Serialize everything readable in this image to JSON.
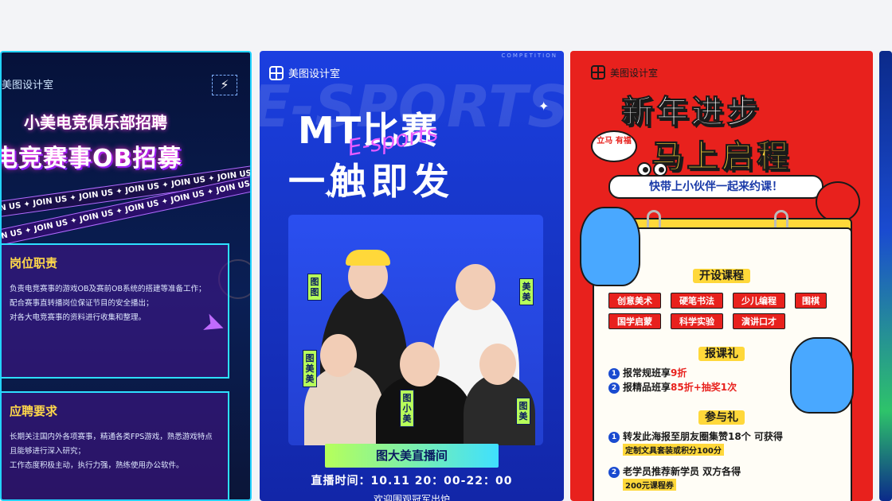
{
  "cards": [
    {
      "brand": "美图设计室",
      "subtitle": "小美电竞俱乐部招聘",
      "title": "电竞赛事OB招募",
      "ribbon": "JOIN US ✦ JOIN US ✦ JOIN US ✦ JOIN US ✦ JOIN US ✦ JOIN US",
      "section1": {
        "heading": "岗位职责",
        "lines": [
          "负责电竞赛事的游戏OB及赛前OB系统的搭建等准备工作；",
          "配合赛事直转播岗位保证节目的安全播出；",
          "对各大电竞赛事的资料进行收集和整理。"
        ]
      },
      "section2": {
        "heading": "应聘要求",
        "lines": [
          "长期关注国内外各项赛事，精通各类FPS游戏，熟悉游戏特点且能够进行深入研究；",
          "工作态度积极主动，执行力强，熟练使用办公软件。"
        ]
      }
    },
    {
      "brand": "美图设计室",
      "corner": "COMPETITION",
      "watermark": "E-SPORTS E-SPORTS",
      "title_line1": "MT比赛",
      "title_line2": "一触即发",
      "script": "E-sports",
      "tags": [
        "图图",
        "美美",
        "图美美",
        "图小美",
        "图美"
      ],
      "live_label": "图大美直播间",
      "time": "直播时间：10.11 20：00-22：00",
      "welcome": "欢迎围观冠军出炉"
    },
    {
      "brand": "美图设计室",
      "title_line1": "新年进步",
      "title_line2": "马上启程",
      "badge": "立马 有福",
      "slogan": "快带上小伙伴一起来约课！",
      "courses_heading": "开设课程",
      "courses": [
        "创意美术",
        "硬笔书法",
        "少儿编程",
        "围棋",
        "国学启蒙",
        "科学实验",
        "演讲口才"
      ],
      "gift_heading": "报课礼",
      "gift_lines": [
        {
          "num": "1",
          "text": "报常规班享",
          "highlight": "9折"
        },
        {
          "num": "2",
          "text": "报精品班享",
          "highlight": "85折+抽奖1次"
        }
      ],
      "join_heading": "参与礼",
      "join_lines": [
        {
          "num": "1",
          "text": "转发此海报至朋友圈集赞18个 可获得",
          "sub": "定制文具套装或积分100分"
        },
        {
          "num": "2",
          "text": "老学员推荐新学员 双方各得",
          "sub": "200元课程券"
        }
      ]
    }
  ],
  "colors": {
    "background": "#f3f4f7",
    "card1_border": "#22d4ff",
    "card2_bg": "#1b3fe0",
    "card3_bg": "#e8211d",
    "accent_yellow": "#ffd83a",
    "accent_green": "#b6ff5a"
  },
  "icons": [
    "lightning-icon",
    "logo-icon",
    "arrow-icon",
    "sparkle-icon"
  ]
}
